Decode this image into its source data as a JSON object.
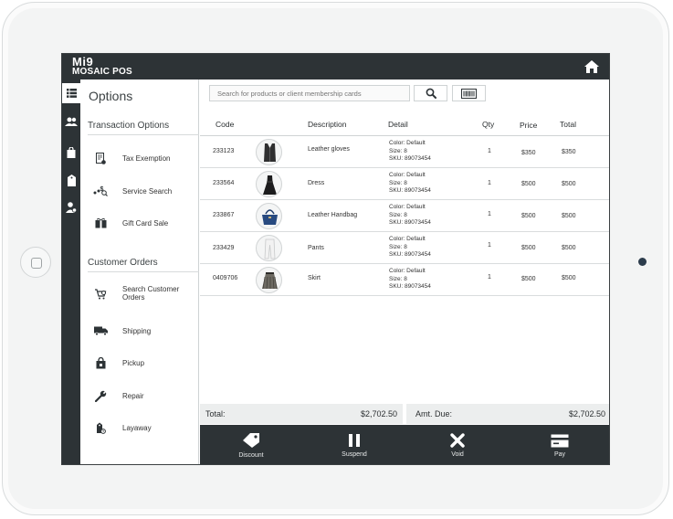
{
  "app": {
    "logo_main": "Mi9",
    "logo_sub": "MOSAIC POS"
  },
  "sidebar": {
    "title": "Options",
    "sections": [
      {
        "heading": "Transaction Options",
        "items": [
          {
            "label": "Tax Exemption",
            "icon": "tax-document-icon"
          },
          {
            "label": "Service Search",
            "icon": "service-search-icon"
          },
          {
            "label": "Gift Card Sale",
            "icon": "gift-card-icon"
          }
        ]
      },
      {
        "heading": "Customer Orders",
        "items": [
          {
            "label": "Search Customer Orders",
            "icon": "search-orders-icon"
          },
          {
            "label": "Shipping",
            "icon": "truck-icon"
          },
          {
            "label": "Pickup",
            "icon": "pickup-icon"
          },
          {
            "label": "Repair",
            "icon": "wrench-icon"
          },
          {
            "label": "Layaway",
            "icon": "layaway-icon"
          }
        ]
      }
    ]
  },
  "search": {
    "placeholder": "Search for products or client membership cards"
  },
  "table": {
    "columns": [
      "Code",
      "Description",
      "Detail",
      "Qty",
      "Price",
      "Total"
    ],
    "rows": [
      {
        "code": "233123",
        "description": "Leather gloves",
        "detail": [
          "Color: Default",
          "Size: 8",
          "SKU: 89073454"
        ],
        "qty": "1",
        "price": "$350",
        "total": "$350",
        "thumb": "vest"
      },
      {
        "code": "233564",
        "description": "Dress",
        "detail": [
          "Color: Default",
          "Size: 8",
          "SKU: 89073454"
        ],
        "qty": "1",
        "price": "$500",
        "total": "$500",
        "thumb": "dress"
      },
      {
        "code": "233867",
        "description": "Leather Handbag",
        "detail": [
          "Color: Default",
          "Size: 8",
          "SKU: 89073454"
        ],
        "qty": "1",
        "price": "$500",
        "total": "$500",
        "thumb": "handbag"
      },
      {
        "code": "233429",
        "description": "Pants",
        "detail": [
          "Color: Default",
          "Size: 8",
          "SKU: 89073454"
        ],
        "qty": "1",
        "price": "$500",
        "total": "$500",
        "thumb": "pants"
      },
      {
        "code": "0409706",
        "description": "Skirt",
        "detail": [
          "Color: Default",
          "Size: 8",
          "SKU: 89073454"
        ],
        "qty": "1",
        "price": "$500",
        "total": "$500",
        "thumb": "skirt"
      }
    ]
  },
  "totals": {
    "total_label": "Total:",
    "total_value": "$2,702.50",
    "due_label": "Amt. Due:",
    "due_value": "$2,702.50"
  },
  "actions": [
    {
      "label": "Discount",
      "icon": "tag-icon"
    },
    {
      "label": "Suspend",
      "icon": "pause-icon"
    },
    {
      "label": "Void",
      "icon": "x-icon"
    },
    {
      "label": "Pay",
      "icon": "card-icon"
    }
  ],
  "colors": {
    "dark_bar": "#2d3336",
    "totals_bg": "#eceeee",
    "text": "#2b2f31"
  }
}
